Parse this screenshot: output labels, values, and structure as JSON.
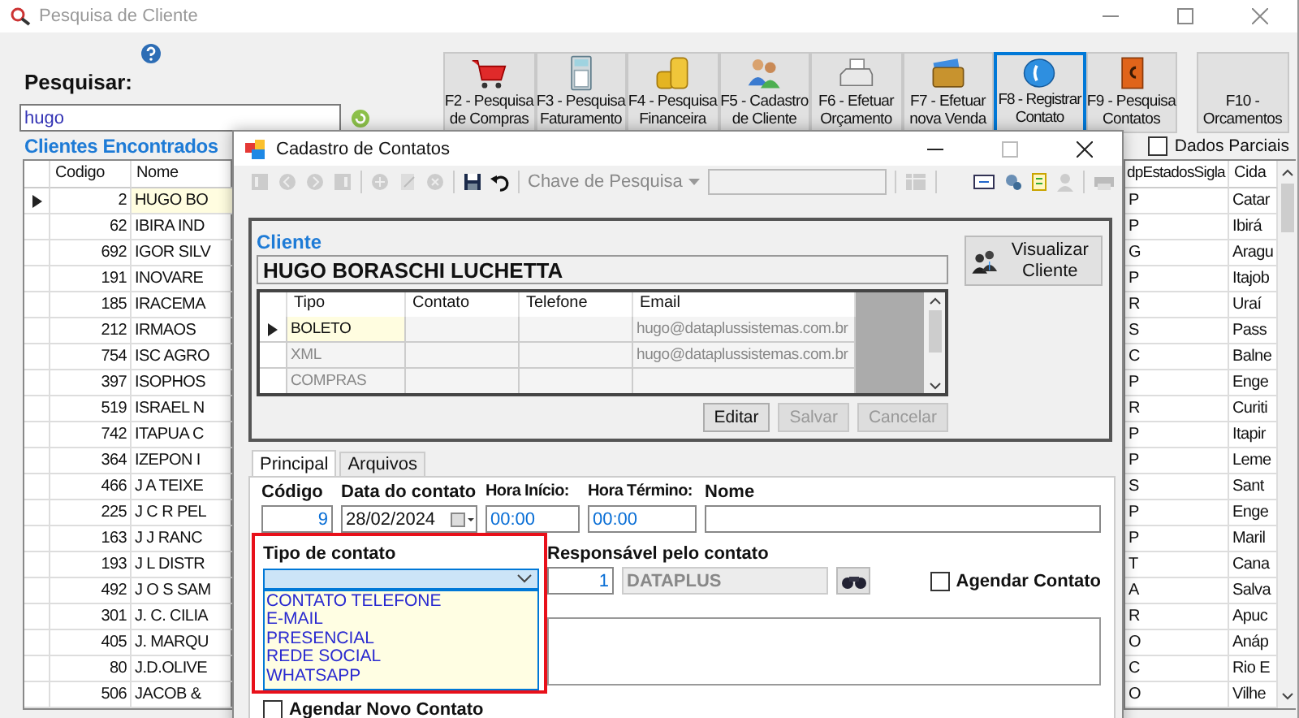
{
  "window": {
    "title": "Pesquisa de Cliente"
  },
  "search": {
    "label": "Pesquisar:",
    "value": "hugo"
  },
  "toolbar": [
    {
      "kind": "cart",
      "lines": [
        "F2 - Pesquisa",
        "de Compras"
      ],
      "selected": false
    },
    {
      "kind": "calculator",
      "lines": [
        "F3 - Pesquisa",
        "Faturamento"
      ],
      "selected": false
    },
    {
      "kind": "coins",
      "lines": [
        "F4 - Pesquisa",
        "Financeira"
      ],
      "selected": false
    },
    {
      "kind": "people",
      "lines": [
        "F5 - Cadastro",
        "de Cliente"
      ],
      "selected": false
    },
    {
      "kind": "register",
      "lines": [
        "F6 - Efetuar",
        "Orçamento"
      ],
      "selected": false
    },
    {
      "kind": "wallet",
      "lines": [
        "F7 - Efetuar",
        "nova Venda"
      ],
      "selected": false
    },
    {
      "kind": "phone",
      "lines": [
        "F8 - Registrar",
        "Contato"
      ],
      "selected": true
    },
    {
      "kind": "book",
      "lines": [
        "F9 - Pesquisa",
        "Contatos"
      ],
      "selected": false
    },
    {
      "kind": "plain",
      "lines": [
        "F10 -",
        "Orcamentos"
      ],
      "selected": false
    }
  ],
  "results": {
    "title": "Clientes Encontrados",
    "partial": {
      "label": "Dados Parciais",
      "checked": false
    },
    "columns": [
      "Codigo",
      "Nome",
      "dpEstadosSigla",
      "Cida"
    ],
    "rows": [
      {
        "code": "2",
        "name": "HUGO BO",
        "state": "P",
        "city": "Catar",
        "selected": true
      },
      {
        "code": "62",
        "name": "IBIRA IND",
        "state": "P",
        "city": "Ibirá",
        "selected": false
      },
      {
        "code": "692",
        "name": "IGOR SILV",
        "state": "G",
        "city": "Aragu",
        "selected": false
      },
      {
        "code": "191",
        "name": "INOVARE",
        "state": "P",
        "city": "Itajob",
        "selected": false
      },
      {
        "code": "185",
        "name": "IRACEMA",
        "state": "R",
        "city": "Uraí",
        "selected": false
      },
      {
        "code": "212",
        "name": "IRMAOS",
        "state": "S",
        "city": "Pass",
        "selected": false
      },
      {
        "code": "754",
        "name": "ISC AGRO",
        "state": "C",
        "city": "Balne",
        "selected": false
      },
      {
        "code": "397",
        "name": "ISOPHOS",
        "state": "P",
        "city": "Enge",
        "selected": false
      },
      {
        "code": "519",
        "name": "ISRAEL N",
        "state": "R",
        "city": "Curiti",
        "selected": false
      },
      {
        "code": "742",
        "name": "ITAPUA C",
        "state": "P",
        "city": "Itapir",
        "selected": false
      },
      {
        "code": "364",
        "name": "IZEPON I",
        "state": "P",
        "city": "Leme",
        "selected": false
      },
      {
        "code": "466",
        "name": "J A TEIXE",
        "state": "S",
        "city": "Sant",
        "selected": false
      },
      {
        "code": "225",
        "name": "J C R PEL",
        "state": "P",
        "city": "Enge",
        "selected": false
      },
      {
        "code": "163",
        "name": "J J RANC",
        "state": "P",
        "city": "Maril",
        "selected": false
      },
      {
        "code": "193",
        "name": "J L DISTR",
        "state": "T",
        "city": "Cana",
        "selected": false
      },
      {
        "code": "492",
        "name": "J O S SAM",
        "state": "A",
        "city": "Salva",
        "selected": false
      },
      {
        "code": "301",
        "name": "J. C. CILIA",
        "state": "R",
        "city": "Apuc",
        "selected": false
      },
      {
        "code": "405",
        "name": "J. MARQU",
        "state": "O",
        "city": "Anáp",
        "selected": false
      },
      {
        "code": "80",
        "name": "J.D.OLIVE",
        "state": "C",
        "city": "Rio E",
        "selected": false
      },
      {
        "code": "506",
        "name": "JACOB &",
        "state": "O",
        "city": "Vilhe",
        "selected": false
      }
    ]
  },
  "dialog": {
    "title": "Cadastro de Contatos",
    "search_key": "Chave de Pesquisa",
    "client": {
      "heading": "Cliente",
      "name": "HUGO BORASCHI LUCHETTA",
      "view_button": "Visualizar Cliente"
    },
    "contacts": {
      "columns": [
        "Tipo",
        "Contato",
        "Telefone",
        "Email"
      ],
      "rows": [
        {
          "type": "BOLETO",
          "email": "hugo@dataplussistemas.com.br",
          "selected": true
        },
        {
          "type": "XML",
          "email": "hugo@dataplussistemas.com.br",
          "selected": false
        },
        {
          "type": "COMPRAS",
          "selected": false
        }
      ]
    },
    "actions": [
      {
        "label": "Editar",
        "disabled": false
      },
      {
        "label": "Salvar",
        "disabled": true
      },
      {
        "label": "Cancelar",
        "disabled": true
      }
    ],
    "tabs": [
      {
        "label": "Principal",
        "selected": true
      },
      {
        "label": "Arquivos",
        "selected": false
      }
    ],
    "form": {
      "code": {
        "label": "Código",
        "value": "9"
      },
      "date": {
        "label": "Data do contato",
        "value": "28/02/2024"
      },
      "start": {
        "label": "Hora Início:",
        "value": "00:00"
      },
      "end": {
        "label": "Hora Término:",
        "value": "00:00"
      },
      "name": {
        "label": "Nome"
      },
      "contact_type": {
        "label": "Tipo de contato",
        "expanded": true,
        "highlighted": true,
        "options": [
          "CONTATO TELEFONE",
          "E-MAIL",
          "PRESENCIAL",
          "REDE SOCIAL",
          "WHATSAPP"
        ]
      },
      "responsible": {
        "label": "Responsável pelo contato",
        "code": "1",
        "name": "DATAPLUS"
      },
      "schedule": {
        "label": "Agendar Contato",
        "checked": false
      },
      "schedule_new": {
        "label": "Agendar Novo Contato",
        "checked": false
      }
    }
  }
}
